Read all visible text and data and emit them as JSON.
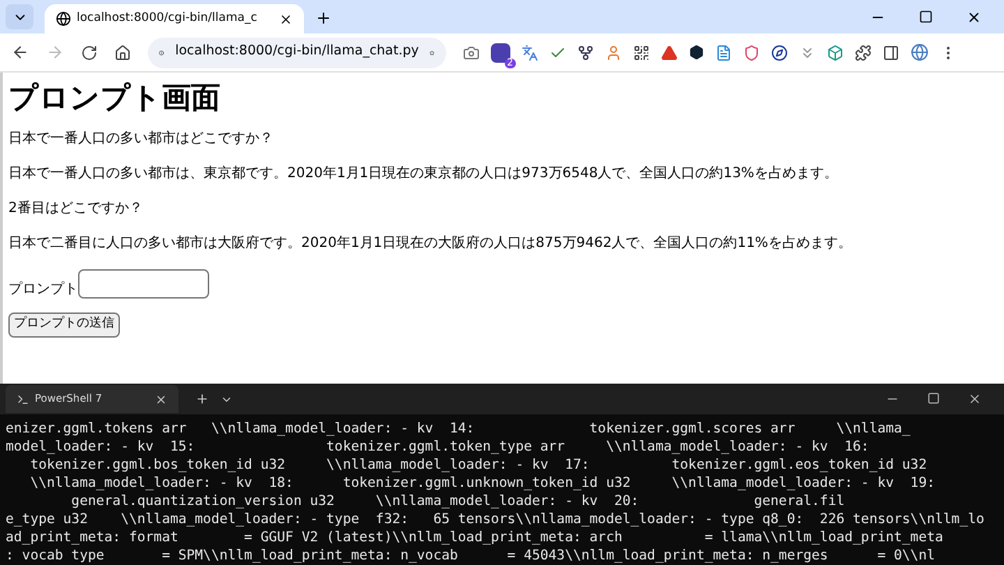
{
  "browser": {
    "tabs": [
      {
        "title": "localhost:8000/cgi-bin/llama_c",
        "selected": true
      }
    ],
    "address": "localhost:8000/cgi-bin/llama_chat.py",
    "extension_badge": "2"
  },
  "page": {
    "heading": "プロンプト画面",
    "messages": [
      "日本で一番人口の多い都市はどこですか？",
      "日本で一番人口の多い都市は、東京都です。2020年1月1日現在の東京都の人口は973万6548人で、全国人口の約13%を占めます。",
      "2番目はどこですか？",
      "日本で二番目に人口の多い都市は大阪府です。2020年1月1日現在の大阪府の人口は875万9462人で、全国人口の約11%を占めます。"
    ],
    "prompt_label": "プロンプト",
    "submit_button": "プロンプトの送信"
  },
  "terminal": {
    "tabs": [
      {
        "title": "PowerShell 7",
        "selected": true
      }
    ],
    "lines": [
      "enizer.ggml.tokens arr   \\\\nllama_model_loader: - kv  14:              tokenizer.ggml.scores arr     \\\\nllama_",
      "model_loader: - kv  15:                tokenizer.ggml.token_type arr     \\\\nllama_model_loader: - kv  16:",
      "   tokenizer.ggml.bos_token_id u32     \\\\nllama_model_loader: - kv  17:          tokenizer.ggml.eos_token_id u32",
      "   \\\\nllama_model_loader: - kv  18:      tokenizer.ggml.unknown_token_id u32     \\\\nllama_model_loader: - kv  19:",
      "        general.quantization_version u32     \\\\nllama_model_loader: - kv  20:              general.fil",
      "e_type u32    \\\\nllama_model_loader: - type  f32:   65 tensors\\\\nllama_model_loader: - type q8_0:  226 tensors\\\\nllm_lo",
      "ad_print_meta: format        = GGUF V2 (latest)\\\\nllm_load_print_meta: arch          = llama\\\\nllm_load_print_meta",
      ": vocab type       = SPM\\\\nllm_load_print_meta: n_vocab      = 45043\\\\nllm_load_print_meta: n_merges      = 0\\\\nl"
    ]
  }
}
